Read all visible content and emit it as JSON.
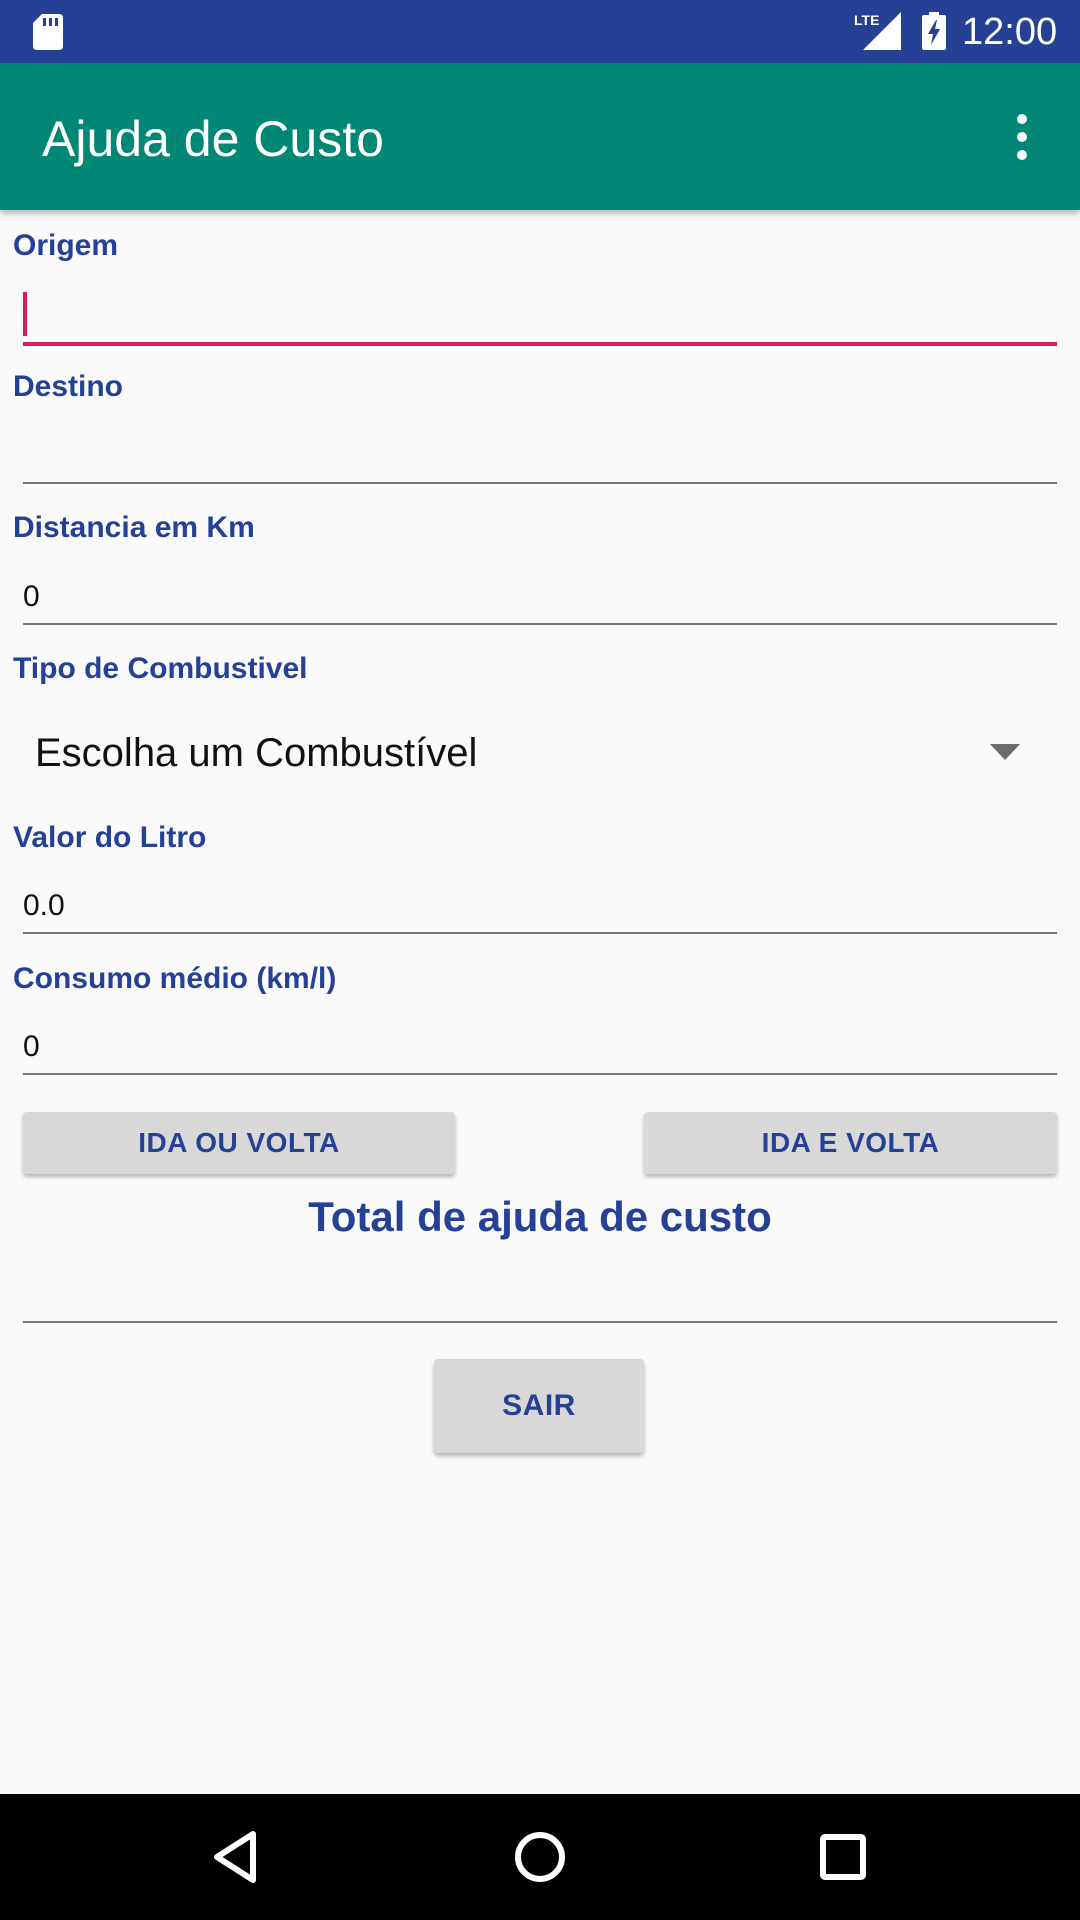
{
  "status_bar": {
    "time": "12:00",
    "network_label": "LTE",
    "icons": [
      "sd-card-icon",
      "signal-icon",
      "battery-charging-icon"
    ]
  },
  "app_bar": {
    "title": "Ajuda de Custo",
    "menu_icon": "overflow-menu-icon"
  },
  "form": {
    "origem": {
      "label": "Origem",
      "value": ""
    },
    "destino": {
      "label": "Destino",
      "value": ""
    },
    "distancia": {
      "label": "Distancia em Km",
      "value": "0"
    },
    "combustivel": {
      "label": "Tipo de Combustivel",
      "selected": "Escolha um Combustível"
    },
    "valor_litro": {
      "label": "Valor do Litro",
      "value": "0.0"
    },
    "consumo": {
      "label": "Consumo médio (km/l)",
      "value": "0"
    }
  },
  "actions": {
    "ida_ou_volta": "IDA OU VOLTA",
    "ida_e_volta": "IDA E VOLTA"
  },
  "total": {
    "title": "Total de ajuda de custo",
    "value": ""
  },
  "exit_button": "SAIR",
  "nav_bar": {
    "icons": [
      "back-icon",
      "home-icon",
      "recents-icon"
    ]
  },
  "colors": {
    "status_bar": "#254195",
    "app_bar": "#018775",
    "label": "#254195",
    "focus_accent": "#d81b60",
    "button_bg": "#d8d8d8"
  }
}
